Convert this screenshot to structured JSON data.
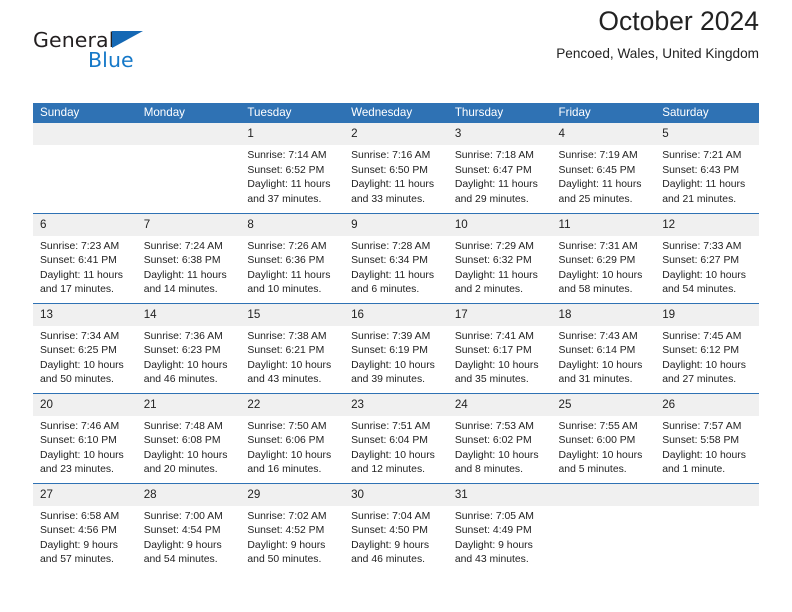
{
  "brand": {
    "line1": "General",
    "line2": "Blue",
    "triangle_color": "#1568b4"
  },
  "header": {
    "title": "October 2024",
    "subtitle": "Pencoed, Wales, United Kingdom",
    "accent_color": "#2f72b4",
    "daynum_band_color": "#f0f0f0"
  },
  "weekdays": [
    "Sunday",
    "Monday",
    "Tuesday",
    "Wednesday",
    "Thursday",
    "Friday",
    "Saturday"
  ],
  "labels": {
    "sunrise": "Sunrise:",
    "sunset": "Sunset:",
    "daylight": "Daylight:"
  },
  "weeks": [
    [
      {
        "day": "",
        "empty": true
      },
      {
        "day": "",
        "empty": true
      },
      {
        "day": "1",
        "sunrise": "Sunrise: 7:14 AM",
        "sunset": "Sunset: 6:52 PM",
        "daylight1": "Daylight: 11 hours",
        "daylight2": "and 37 minutes."
      },
      {
        "day": "2",
        "sunrise": "Sunrise: 7:16 AM",
        "sunset": "Sunset: 6:50 PM",
        "daylight1": "Daylight: 11 hours",
        "daylight2": "and 33 minutes."
      },
      {
        "day": "3",
        "sunrise": "Sunrise: 7:18 AM",
        "sunset": "Sunset: 6:47 PM",
        "daylight1": "Daylight: 11 hours",
        "daylight2": "and 29 minutes."
      },
      {
        "day": "4",
        "sunrise": "Sunrise: 7:19 AM",
        "sunset": "Sunset: 6:45 PM",
        "daylight1": "Daylight: 11 hours",
        "daylight2": "and 25 minutes."
      },
      {
        "day": "5",
        "sunrise": "Sunrise: 7:21 AM",
        "sunset": "Sunset: 6:43 PM",
        "daylight1": "Daylight: 11 hours",
        "daylight2": "and 21 minutes."
      }
    ],
    [
      {
        "day": "6",
        "sunrise": "Sunrise: 7:23 AM",
        "sunset": "Sunset: 6:41 PM",
        "daylight1": "Daylight: 11 hours",
        "daylight2": "and 17 minutes."
      },
      {
        "day": "7",
        "sunrise": "Sunrise: 7:24 AM",
        "sunset": "Sunset: 6:38 PM",
        "daylight1": "Daylight: 11 hours",
        "daylight2": "and 14 minutes."
      },
      {
        "day": "8",
        "sunrise": "Sunrise: 7:26 AM",
        "sunset": "Sunset: 6:36 PM",
        "daylight1": "Daylight: 11 hours",
        "daylight2": "and 10 minutes."
      },
      {
        "day": "9",
        "sunrise": "Sunrise: 7:28 AM",
        "sunset": "Sunset: 6:34 PM",
        "daylight1": "Daylight: 11 hours",
        "daylight2": "and 6 minutes."
      },
      {
        "day": "10",
        "sunrise": "Sunrise: 7:29 AM",
        "sunset": "Sunset: 6:32 PM",
        "daylight1": "Daylight: 11 hours",
        "daylight2": "and 2 minutes."
      },
      {
        "day": "11",
        "sunrise": "Sunrise: 7:31 AM",
        "sunset": "Sunset: 6:29 PM",
        "daylight1": "Daylight: 10 hours",
        "daylight2": "and 58 minutes."
      },
      {
        "day": "12",
        "sunrise": "Sunrise: 7:33 AM",
        "sunset": "Sunset: 6:27 PM",
        "daylight1": "Daylight: 10 hours",
        "daylight2": "and 54 minutes."
      }
    ],
    [
      {
        "day": "13",
        "sunrise": "Sunrise: 7:34 AM",
        "sunset": "Sunset: 6:25 PM",
        "daylight1": "Daylight: 10 hours",
        "daylight2": "and 50 minutes."
      },
      {
        "day": "14",
        "sunrise": "Sunrise: 7:36 AM",
        "sunset": "Sunset: 6:23 PM",
        "daylight1": "Daylight: 10 hours",
        "daylight2": "and 46 minutes."
      },
      {
        "day": "15",
        "sunrise": "Sunrise: 7:38 AM",
        "sunset": "Sunset: 6:21 PM",
        "daylight1": "Daylight: 10 hours",
        "daylight2": "and 43 minutes."
      },
      {
        "day": "16",
        "sunrise": "Sunrise: 7:39 AM",
        "sunset": "Sunset: 6:19 PM",
        "daylight1": "Daylight: 10 hours",
        "daylight2": "and 39 minutes."
      },
      {
        "day": "17",
        "sunrise": "Sunrise: 7:41 AM",
        "sunset": "Sunset: 6:17 PM",
        "daylight1": "Daylight: 10 hours",
        "daylight2": "and 35 minutes."
      },
      {
        "day": "18",
        "sunrise": "Sunrise: 7:43 AM",
        "sunset": "Sunset: 6:14 PM",
        "daylight1": "Daylight: 10 hours",
        "daylight2": "and 31 minutes."
      },
      {
        "day": "19",
        "sunrise": "Sunrise: 7:45 AM",
        "sunset": "Sunset: 6:12 PM",
        "daylight1": "Daylight: 10 hours",
        "daylight2": "and 27 minutes."
      }
    ],
    [
      {
        "day": "20",
        "sunrise": "Sunrise: 7:46 AM",
        "sunset": "Sunset: 6:10 PM",
        "daylight1": "Daylight: 10 hours",
        "daylight2": "and 23 minutes."
      },
      {
        "day": "21",
        "sunrise": "Sunrise: 7:48 AM",
        "sunset": "Sunset: 6:08 PM",
        "daylight1": "Daylight: 10 hours",
        "daylight2": "and 20 minutes."
      },
      {
        "day": "22",
        "sunrise": "Sunrise: 7:50 AM",
        "sunset": "Sunset: 6:06 PM",
        "daylight1": "Daylight: 10 hours",
        "daylight2": "and 16 minutes."
      },
      {
        "day": "23",
        "sunrise": "Sunrise: 7:51 AM",
        "sunset": "Sunset: 6:04 PM",
        "daylight1": "Daylight: 10 hours",
        "daylight2": "and 12 minutes."
      },
      {
        "day": "24",
        "sunrise": "Sunrise: 7:53 AM",
        "sunset": "Sunset: 6:02 PM",
        "daylight1": "Daylight: 10 hours",
        "daylight2": "and 8 minutes."
      },
      {
        "day": "25",
        "sunrise": "Sunrise: 7:55 AM",
        "sunset": "Sunset: 6:00 PM",
        "daylight1": "Daylight: 10 hours",
        "daylight2": "and 5 minutes."
      },
      {
        "day": "26",
        "sunrise": "Sunrise: 7:57 AM",
        "sunset": "Sunset: 5:58 PM",
        "daylight1": "Daylight: 10 hours",
        "daylight2": "and 1 minute."
      }
    ],
    [
      {
        "day": "27",
        "sunrise": "Sunrise: 6:58 AM",
        "sunset": "Sunset: 4:56 PM",
        "daylight1": "Daylight: 9 hours",
        "daylight2": "and 57 minutes."
      },
      {
        "day": "28",
        "sunrise": "Sunrise: 7:00 AM",
        "sunset": "Sunset: 4:54 PM",
        "daylight1": "Daylight: 9 hours",
        "daylight2": "and 54 minutes."
      },
      {
        "day": "29",
        "sunrise": "Sunrise: 7:02 AM",
        "sunset": "Sunset: 4:52 PM",
        "daylight1": "Daylight: 9 hours",
        "daylight2": "and 50 minutes."
      },
      {
        "day": "30",
        "sunrise": "Sunrise: 7:04 AM",
        "sunset": "Sunset: 4:50 PM",
        "daylight1": "Daylight: 9 hours",
        "daylight2": "and 46 minutes."
      },
      {
        "day": "31",
        "sunrise": "Sunrise: 7:05 AM",
        "sunset": "Sunset: 4:49 PM",
        "daylight1": "Daylight: 9 hours",
        "daylight2": "and 43 minutes."
      },
      {
        "day": "",
        "empty": true
      },
      {
        "day": "",
        "empty": true
      }
    ]
  ]
}
